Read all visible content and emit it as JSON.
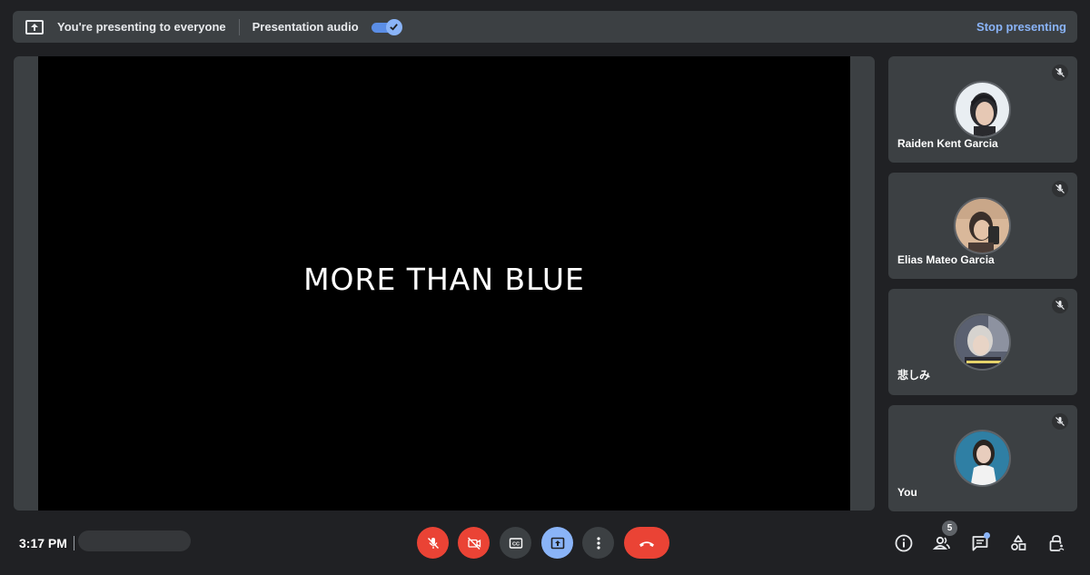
{
  "topbar": {
    "presenting_text": "You're presenting to everyone",
    "audio_label": "Presentation audio",
    "audio_enabled": true,
    "stop_label": "Stop presenting"
  },
  "stage": {
    "slide_text": "MORE THAN BLUE"
  },
  "participants": [
    {
      "name": "Raiden Kent Garcia",
      "muted": true,
      "avatar_color": "#e9eef2"
    },
    {
      "name": "Elias Mateo Garcia",
      "muted": true,
      "avatar_color": "#d9b89a"
    },
    {
      "name": "悲しみ",
      "muted": true,
      "avatar_color": "#5a6070"
    },
    {
      "name": "You",
      "muted": true,
      "avatar_color": "#2f7fa4"
    }
  ],
  "bottombar": {
    "time": "3:17 PM",
    "participants_count": "5",
    "controls": [
      "mic-off",
      "camera-off",
      "captions",
      "present",
      "more",
      "leave-call"
    ],
    "right_controls": [
      "info",
      "people",
      "chat",
      "activities",
      "host-controls"
    ]
  },
  "colors": {
    "background": "#202124",
    "panel": "#3c4043",
    "accent_blue": "#8ab4f8",
    "danger_red": "#ea4335"
  }
}
